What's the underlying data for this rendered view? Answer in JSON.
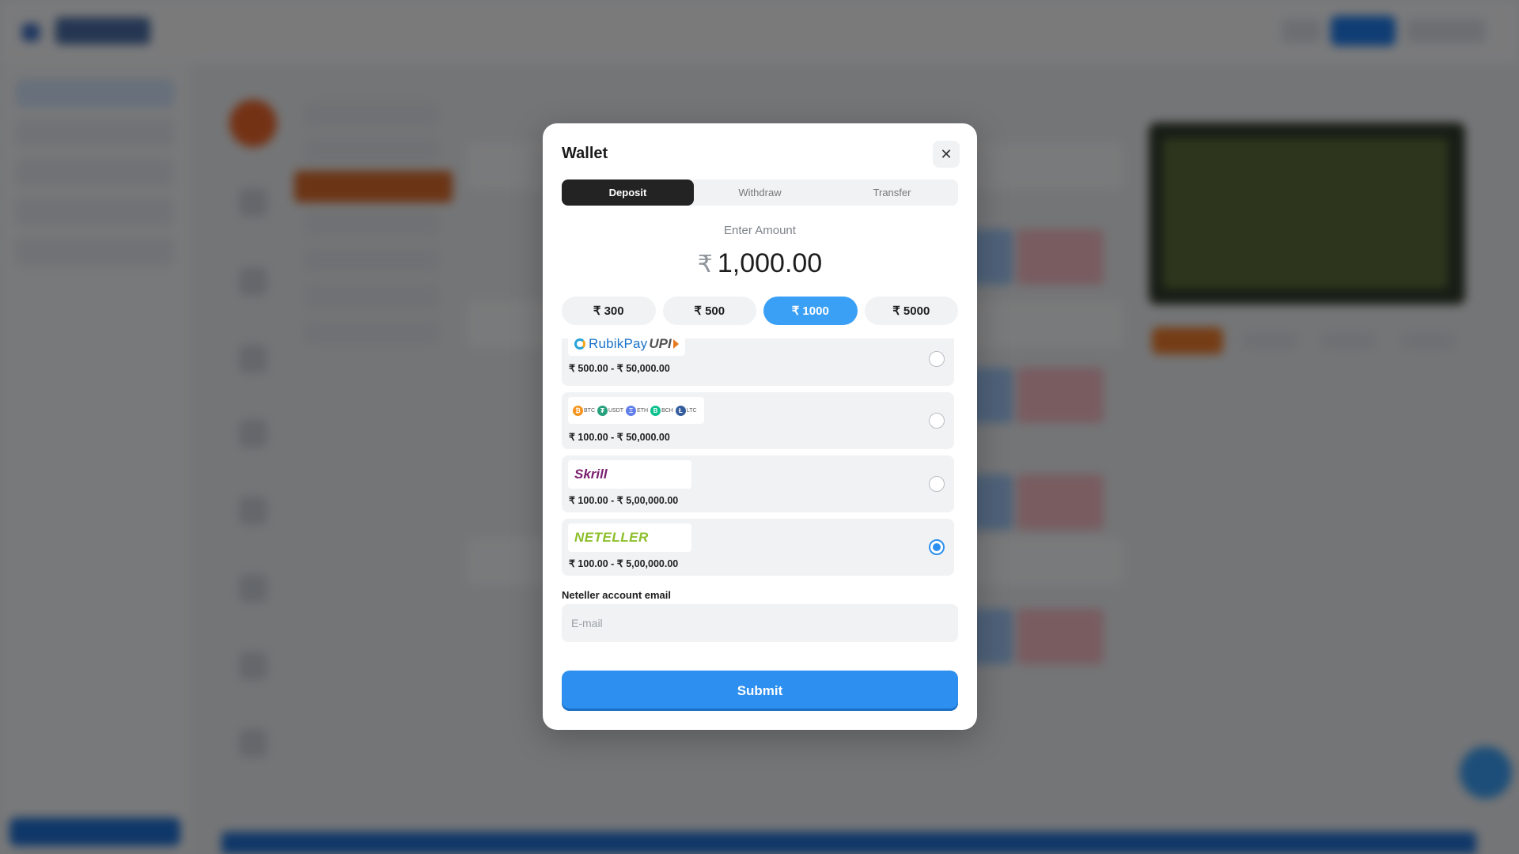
{
  "wallet": {
    "title": "Wallet",
    "close_glyph": "✕",
    "tabs": [
      {
        "label": "Deposit",
        "active": true
      },
      {
        "label": "Withdraw",
        "active": false
      },
      {
        "label": "Transfer",
        "active": false
      }
    ],
    "enter_amount_label": "Enter Amount",
    "currency_symbol": "₹",
    "amount_value": "1,000.00",
    "quick_amounts": [
      {
        "label": "₹ 300",
        "active": false
      },
      {
        "label": "₹ 500",
        "active": false
      },
      {
        "label": "₹ 1000",
        "active": true
      },
      {
        "label": "₹ 5000",
        "active": false
      }
    ],
    "payment_methods": [
      {
        "name": "RubikPay UPI",
        "logo_text": "RubikPay",
        "logo_suffix": "UPI",
        "range": "₹ 500.00 - ₹ 50,000.00",
        "selected": false
      },
      {
        "name": "Crypto",
        "coins": [
          {
            "symbol": "₿",
            "label": "BTC",
            "color": "#f7931a"
          },
          {
            "symbol": "₮",
            "label": "USDT",
            "color": "#26a17b"
          },
          {
            "symbol": "Ξ",
            "label": "ETH",
            "color": "#627eea"
          },
          {
            "symbol": "B",
            "label": "BCH",
            "color": "#0ac18e"
          },
          {
            "symbol": "Ł",
            "label": "LTC",
            "color": "#345d9d"
          }
        ],
        "range": "₹ 100.00 - ₹ 50,000.00",
        "selected": false
      },
      {
        "name": "Skrill",
        "logo_text": "Skrill",
        "range": "₹ 100.00 - ₹ 5,00,000.00",
        "selected": false
      },
      {
        "name": "Neteller",
        "logo_text": "NETELLER",
        "range": "₹ 100.00 - ₹ 5,00,000.00",
        "selected": true
      }
    ],
    "email_field": {
      "label": "Neteller account email",
      "placeholder": "E-mail",
      "value": ""
    },
    "submit_label": "Submit"
  },
  "colors": {
    "accent": "#2d8ff0",
    "quick_active": "#3aa0f6",
    "tab_active_bg": "#232323",
    "overlay": "rgba(0,0,0,0.5)"
  },
  "icons": {
    "close": "close-icon",
    "chat": "chat-icon",
    "radio_selected": "radio-checked-icon"
  }
}
